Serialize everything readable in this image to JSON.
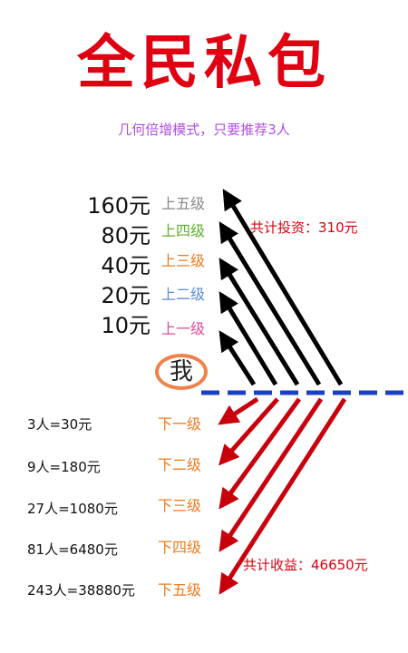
{
  "title": "全民私包",
  "subtitle": "几何倍增模式，只要推荐3人",
  "me_label": "我",
  "upper_levels": [
    {
      "amount": "160元",
      "label": "上五级",
      "color": "#888888"
    },
    {
      "amount": "80元",
      "label": "上四级",
      "color": "#5fae2e"
    },
    {
      "amount": "40元",
      "label": "上三级",
      "color": "#f07a1c"
    },
    {
      "amount": "20元",
      "label": "上二级",
      "color": "#5b8ed8"
    },
    {
      "amount": "10元",
      "label": "上一级",
      "color": "#e04a9a"
    }
  ],
  "total_invest": "共计投资：310元",
  "lower_levels": [
    {
      "count": "3人=30元",
      "label": "下一级"
    },
    {
      "count": "9人=180元",
      "label": "下二级"
    },
    {
      "count": "27人=1080元",
      "label": "下三级"
    },
    {
      "count": "81人=6480元",
      "label": "下四级"
    },
    {
      "count": "243人=38880元",
      "label": "下五级"
    }
  ],
  "total_income": "共计收益：46650元",
  "colors": {
    "title": "#e00012",
    "up_arrows": "#000000",
    "down_arrows": "#c8000c",
    "divider": "#1a3fc4"
  }
}
